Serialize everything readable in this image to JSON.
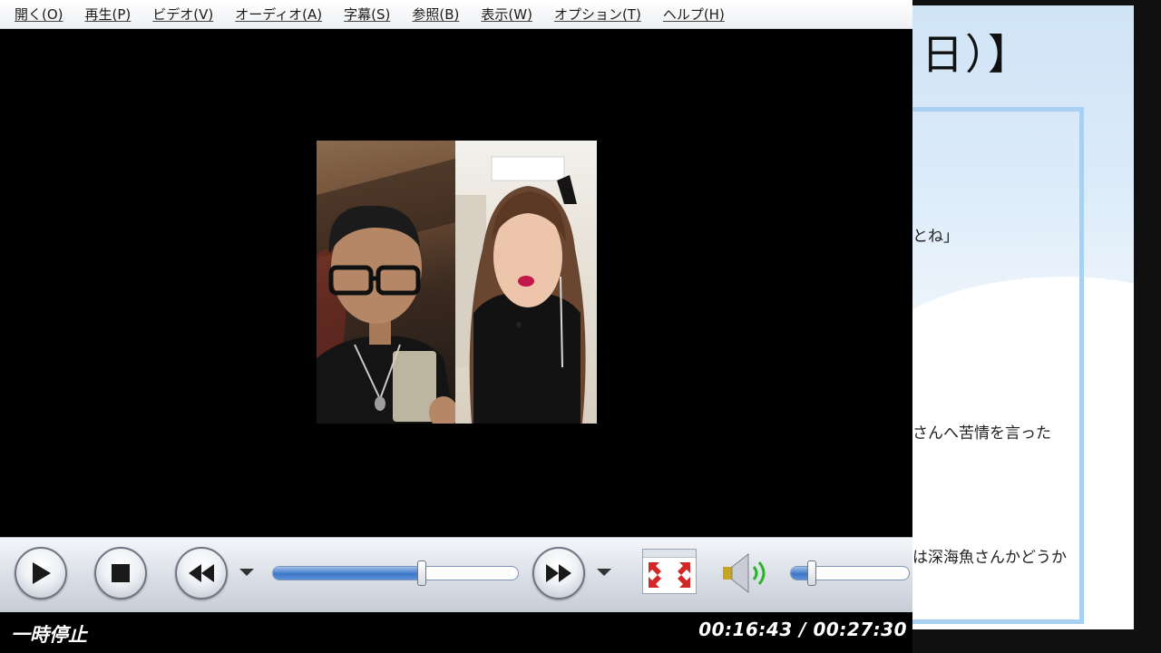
{
  "menu": {
    "items": [
      "開く(O)",
      "再生(P)",
      "ビデオ(V)",
      "オーディオ(A)",
      "字幕(S)",
      "参照(B)",
      "表示(W)",
      "オプション(T)",
      "ヘルプ(H)"
    ]
  },
  "playback": {
    "state": "一時停止",
    "current_time": "00:16:43",
    "total_time": "00:27:30",
    "time_separator": "/",
    "progress_fraction": 0.608,
    "volume_fraction": 0.18
  },
  "icons": {
    "play": "play-icon",
    "stop": "stop-icon",
    "rewind": "rewind-icon",
    "fast_forward": "fast-forward-icon",
    "fullscreen": "fullscreen-icon",
    "volume": "speaker-icon"
  },
  "colors": {
    "accent_blue": "#3f78c9",
    "status_text": "#ffffff",
    "fullscreen_arrow": "#d32626",
    "volume_wave": "#2fb12f"
  },
  "background_doc": {
    "title_fragment": "日）】",
    "line1": "とね」",
    "line2": "さんへ苦情を言った",
    "line3": "は深海魚さんかどうか"
  }
}
